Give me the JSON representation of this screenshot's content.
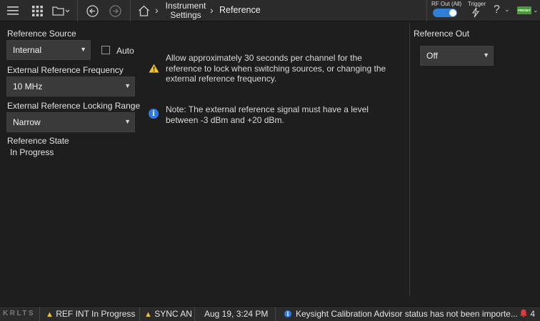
{
  "toolbar": {
    "icons": [
      "hamburger-menu-icon",
      "apps-grid-icon",
      "folder-icon",
      "back-arrow-icon",
      "forward-arrow-icon",
      "home-icon"
    ],
    "breadcrumb": {
      "parent_line1": "Instrument",
      "parent_line2": "Settings",
      "current": "Reference"
    },
    "rf_out_label": "RF Out (All)",
    "rf_out_on": true,
    "trigger_label": "Trigger",
    "help_symbol": "?",
    "preset_label": "PRESET"
  },
  "reference": {
    "source_label": "Reference Source",
    "source_value": "Internal",
    "auto_label": "Auto",
    "auto_checked": false,
    "ext_freq_label": "External Reference Frequency",
    "ext_freq_value": "10 MHz",
    "locking_range_label": "External Reference Locking Range",
    "locking_range_value": "Narrow",
    "state_label": "Reference State",
    "state_value": "In Progress"
  },
  "messages": {
    "warning_line1": "Allow approximately 30 seconds per channel for the",
    "warning_line2": "reference to lock when switching sources, or changing the",
    "warning_line3": "external reference frequency.",
    "note_line1": "Note: The external reference signal must have a level",
    "note_line2": "between -3 dBm and +20 dBm."
  },
  "reference_out": {
    "label": "Reference Out",
    "value": "Off"
  },
  "status_bar": {
    "logo": "KRLTS",
    "ref_status": "REF INT  In Progress",
    "sync_status": "SYNC AN",
    "datetime": "Aug 19, 3:24 PM",
    "advisor_message": "Keysight Calibration Advisor status has not been importe...",
    "alert_count": "4"
  },
  "colors": {
    "accent_blue": "#2d7be0",
    "warning_yellow": "#f1c232",
    "alert_red": "#e03a3a",
    "preset_green": "#4a9a3a"
  }
}
